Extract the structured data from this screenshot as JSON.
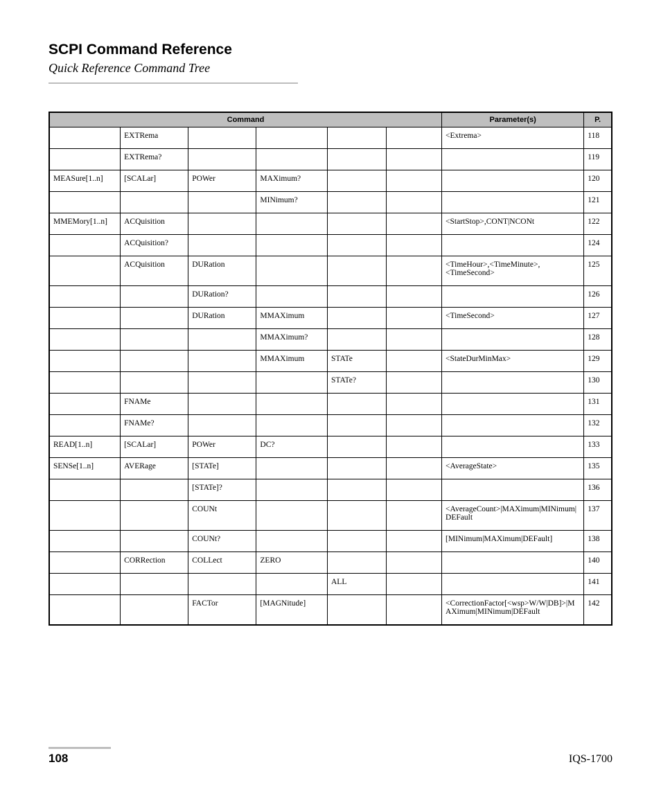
{
  "header": {
    "title": "SCPI Command Reference",
    "subtitle": "Quick Reference Command Tree"
  },
  "table": {
    "headers": {
      "command": "Command",
      "parameters": "Parameter(s)",
      "page": "P."
    },
    "rows": [
      {
        "c": [
          "",
          "EXTRema",
          "",
          "",
          "",
          ""
        ],
        "param": "<Extrema>",
        "page": "118"
      },
      {
        "c": [
          "",
          "EXTRema?",
          "",
          "",
          "",
          ""
        ],
        "param": "",
        "page": "119"
      },
      {
        "c": [
          "MEASure[1..n]",
          "[SCALar]",
          "POWer",
          "MAXimum?",
          "",
          ""
        ],
        "param": "",
        "page": "120"
      },
      {
        "c": [
          "",
          "",
          "",
          "MINimum?",
          "",
          ""
        ],
        "param": "",
        "page": "121"
      },
      {
        "c": [
          "MMEMory[1..n]",
          "ACQuisition",
          "",
          "",
          "",
          ""
        ],
        "param": "<StartStop>,CONT|NCONt",
        "page": "122"
      },
      {
        "c": [
          "",
          "ACQuisition?",
          "",
          "",
          "",
          ""
        ],
        "param": "",
        "page": "124"
      },
      {
        "c": [
          "",
          "ACQuisition",
          "DURation",
          "",
          "",
          ""
        ],
        "param": "<TimeHour>,<TimeMinute>,<TimeSecond>",
        "page": "125"
      },
      {
        "c": [
          "",
          "",
          "DURation?",
          "",
          "",
          ""
        ],
        "param": "",
        "page": "126"
      },
      {
        "c": [
          "",
          "",
          "DURation",
          "MMAXimum",
          "",
          ""
        ],
        "param": "<TimeSecond>",
        "page": "127"
      },
      {
        "c": [
          "",
          "",
          "",
          "MMAXimum?",
          "",
          ""
        ],
        "param": "",
        "page": "128"
      },
      {
        "c": [
          "",
          "",
          "",
          "MMAXimum",
          "STATe",
          ""
        ],
        "param": "<StateDurMinMax>",
        "page": "129"
      },
      {
        "c": [
          "",
          "",
          "",
          "",
          "STATe?",
          ""
        ],
        "param": "",
        "page": "130"
      },
      {
        "c": [
          "",
          "FNAMe",
          "",
          "",
          "",
          ""
        ],
        "param": "",
        "page": "131"
      },
      {
        "c": [
          "",
          "FNAMe?",
          "",
          "",
          "",
          ""
        ],
        "param": "",
        "page": "132"
      },
      {
        "c": [
          "READ[1..n]",
          "[SCALar]",
          "POWer",
          "DC?",
          "",
          ""
        ],
        "param": "",
        "page": "133"
      },
      {
        "c": [
          "SENSe[1..n]",
          "AVERage",
          "[STATe]",
          "",
          "",
          ""
        ],
        "param": "<AverageState>",
        "page": "135"
      },
      {
        "c": [
          "",
          "",
          "[STATe]?",
          "",
          "",
          ""
        ],
        "param": "",
        "page": "136"
      },
      {
        "c": [
          "",
          "",
          "COUNt",
          "",
          "",
          ""
        ],
        "param": "<AverageCount>|MAXimum|MINimum|DEFault",
        "page": "137"
      },
      {
        "c": [
          "",
          "",
          "COUNt?",
          "",
          "",
          ""
        ],
        "param": "[MINimum|MAXimum|DEFault]",
        "page": "138"
      },
      {
        "c": [
          "",
          "CORRection",
          "COLLect",
          "ZERO",
          "",
          ""
        ],
        "param": "",
        "page": "140"
      },
      {
        "c": [
          "",
          "",
          "",
          "",
          "ALL",
          ""
        ],
        "param": "",
        "page": "141"
      },
      {
        "c": [
          "",
          "",
          "FACTor",
          "[MAGNitude]",
          "",
          ""
        ],
        "param": "<CorrectionFactor[<wsp>W/W|DB]>|MAXimum|MINimum|DEFault",
        "page": "142"
      }
    ]
  },
  "footer": {
    "page_number": "108",
    "device": "IQS-1700"
  }
}
